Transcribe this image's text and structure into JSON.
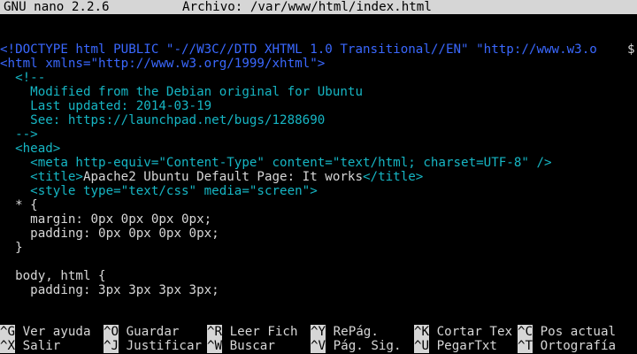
{
  "titlebar": {
    "app": "GNU nano 2.2.6",
    "file": "Archivo: /var/www/html/index.html"
  },
  "editor": {
    "lines": [
      {
        "text": "",
        "color": "white"
      },
      {
        "text": "<!DOCTYPE html PUBLIC \"-//W3C//DTD XHTML 1.0 Transitional//EN\" \"http://www.w3.o",
        "color": "blue"
      },
      {
        "text": "<html xmlns=\"http://www.w3.org/1999/xhtml\">",
        "color": "blue"
      },
      {
        "text": "  <!--",
        "color": "cyan"
      },
      {
        "text": "    Modified from the Debian original for Ubuntu",
        "color": "cyan"
      },
      {
        "text": "    Last updated: 2014-03-19",
        "color": "cyan"
      },
      {
        "text": "    See: https://launchpad.net/bugs/1288690",
        "color": "cyan"
      },
      {
        "text": "  -->",
        "color": "cyan"
      },
      {
        "text": "  <head>",
        "color": "cyan"
      },
      {
        "text": "    <meta http-equiv=\"Content-Type\" content=\"text/html; charset=UTF-8\" />",
        "color": "cyan"
      },
      {
        "text": "    <title>Apache2 Ubuntu Default Page: It works</title>",
        "color": "cyan"
      },
      {
        "text": "    <style type=\"text/css\" media=\"screen\">",
        "color": "cyan"
      },
      {
        "text": "  * {",
        "color": "white"
      },
      {
        "text": "    margin: 0px 0px 0px 0px;",
        "color": "white"
      },
      {
        "text": "    padding: 0px 0px 0px 0px;",
        "color": "white"
      },
      {
        "text": "  }",
        "color": "white"
      },
      {
        "text": "",
        "color": "white"
      },
      {
        "text": "  body, html {",
        "color": "white"
      },
      {
        "text": "    padding: 3px 3px 3px 3px;",
        "color": "white"
      }
    ],
    "wrap_marker": "$"
  },
  "title_inline": {
    "before": "    <title>",
    "middle": "Apache2 Ubuntu Default Page: It works",
    "after": "</title>"
  },
  "shortcuts": [
    {
      "key": "^G",
      "label": "Ver ayuda"
    },
    {
      "key": "^O",
      "label": "Guardar"
    },
    {
      "key": "^R",
      "label": "Leer Fich"
    },
    {
      "key": "^Y",
      "label": "RePág."
    },
    {
      "key": "^K",
      "label": "Cortar Tex"
    },
    {
      "key": "^C",
      "label": "Pos actual"
    },
    {
      "key": "^X",
      "label": "Salir"
    },
    {
      "key": "^J",
      "label": "Justificar"
    },
    {
      "key": "^W",
      "label": "Buscar"
    },
    {
      "key": "^V",
      "label": "Pág. Sig."
    },
    {
      "key": "^U",
      "label": "PegarTxt"
    },
    {
      "key": "^T",
      "label": "Ortografía"
    }
  ],
  "colors": {
    "background": "#000000",
    "bar": "#d6d6d6",
    "markup_blue": "#3a68ff",
    "comment_cyan": "#16b6c4",
    "text_white": "#d7d7d7"
  }
}
